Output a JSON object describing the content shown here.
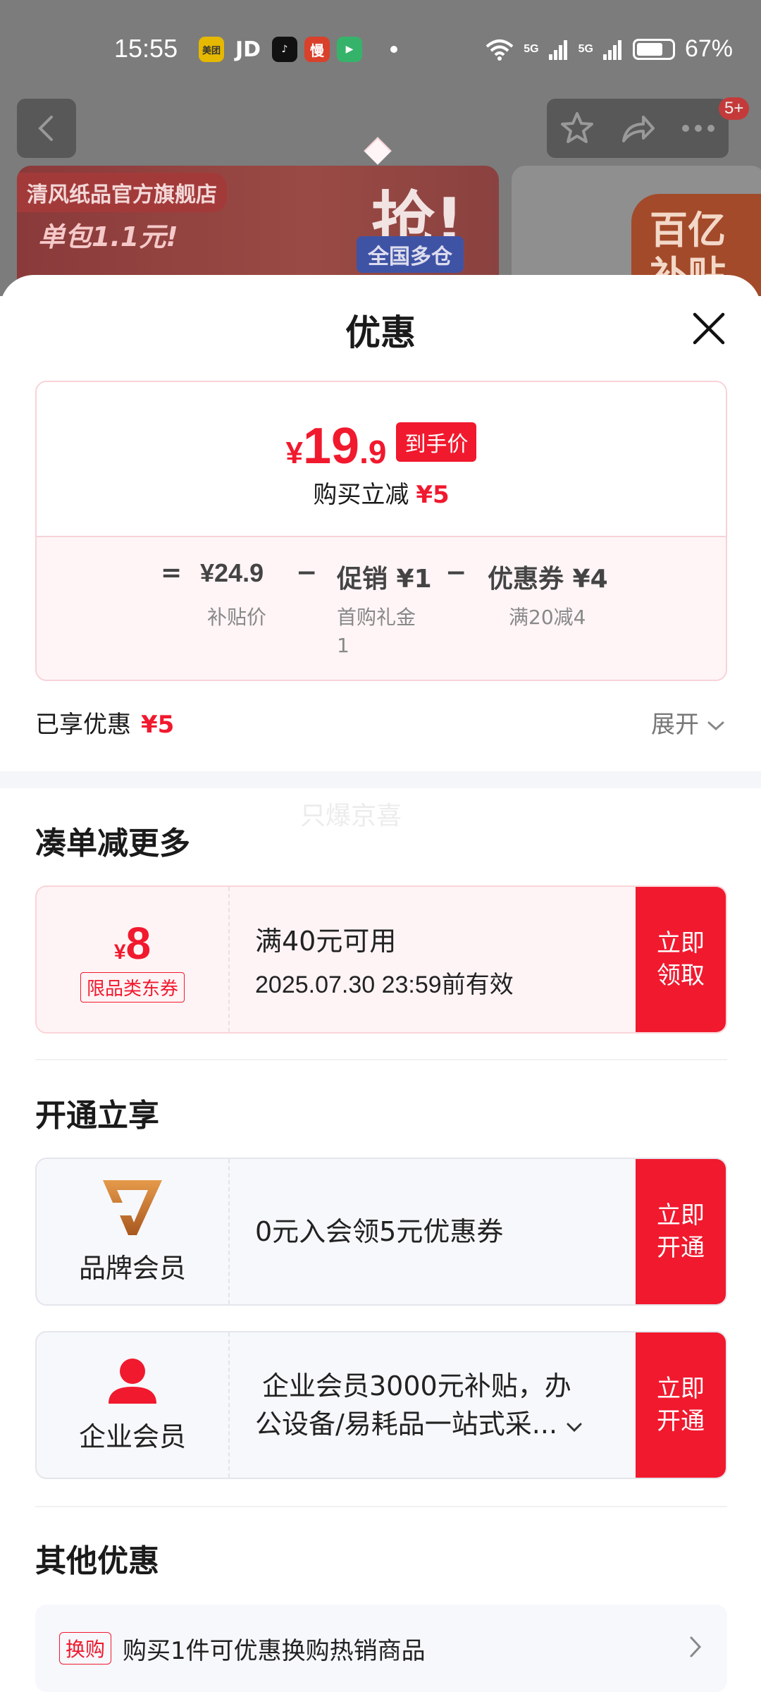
{
  "status_bar": {
    "time": "15:55",
    "apps": [
      "美团",
      "JD",
      "抖音",
      "慢",
      "播"
    ],
    "signal_1": "5G",
    "signal_2": "5G",
    "battery": "67%"
  },
  "background": {
    "shop_name": "清风纸品官方旗舰店",
    "promo_big": "抢!",
    "promo_sub": "全国多仓",
    "pack_text": "单包1.1元!",
    "subsidy_text": "百亿补贴",
    "notification_badge": "5+"
  },
  "sheet": {
    "title": "优惠",
    "price": {
      "currency": "¥",
      "integer": "19",
      "decimal": ".9",
      "tag": "到手价",
      "reduce_label": "购买立减",
      "reduce_amount": "¥5"
    },
    "breakdown": {
      "equals": "=",
      "base_value": "¥24.9",
      "base_label": "补贴价",
      "minus_1": "−",
      "promo_value": "促销 ¥1",
      "promo_label_1": "首购礼金",
      "promo_label_2": "1",
      "minus_2": "−",
      "coupon_value": "优惠券 ¥4",
      "coupon_label": "满20减4"
    },
    "enjoyed_label": "已享优惠",
    "enjoyed_amount": "¥5",
    "expand_label": "展开",
    "watermark": "只爆京喜"
  },
  "more_section": {
    "title": "凑单减更多",
    "coupon": {
      "currency": "¥",
      "amount": "8",
      "type": "限品类东券",
      "condition": "满40元可用",
      "validity": "2025.07.30 23:59前有效",
      "button": "立即领取"
    }
  },
  "open_section": {
    "title": "开通立享",
    "brand_member": {
      "label": "品牌会员",
      "offer": "0元入会领5元优惠券",
      "button": "立即开通"
    },
    "enterprise_member": {
      "label": "企业会员",
      "offer_line1": "企业会员3000元补贴，办",
      "offer_line2": "公设备/易耗品一站式采...",
      "button": "立即开通"
    }
  },
  "other_section": {
    "title": "其他优惠",
    "tag": "换购",
    "text": "购买1件可优惠换购热销商品"
  },
  "colors": {
    "accent": "#f1192e",
    "card_border": "#f7d3d8",
    "card_bg": "#fff5f6",
    "brand_member_gold": "#c8792a"
  }
}
